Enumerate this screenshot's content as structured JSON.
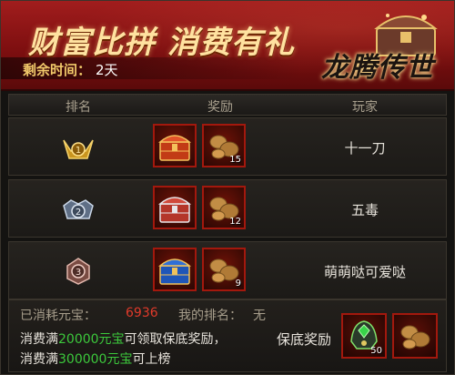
{
  "banner": {
    "title": "财富比拼  消费有礼",
    "remaining_label": "剩余时间：",
    "remaining_value": "2天",
    "logo_text": "龙腾传世"
  },
  "table": {
    "headers": {
      "rank": "排名",
      "reward": "奖励",
      "player": "玩家"
    },
    "rows": [
      {
        "rank": 1,
        "rank_icon": "gold-medal-1",
        "chest": "red-treasure-chest",
        "ore_qty": "15",
        "player": "十一刀"
      },
      {
        "rank": 2,
        "rank_icon": "silver-medal-2",
        "chest": "silver-treasure-chest",
        "ore_qty": "12",
        "player": "五毒"
      },
      {
        "rank": 3,
        "rank_icon": "bronze-medal-3",
        "chest": "blue-treasure-chest",
        "ore_qty": "9",
        "player": "萌萌哒可爱哒"
      }
    ]
  },
  "footer": {
    "spent_label": "已消耗元宝：",
    "spent_value": "6936",
    "my_rank_label": "我的排名：",
    "my_rank_value": "无",
    "line1_a": "消费满",
    "line1_hl": "20000元宝",
    "line1_b": "可领取保底奖励，",
    "line2_a": "消费满",
    "line2_hl": "300000元宝",
    "line2_b": "可上榜",
    "guarantee_label": "保底奖励",
    "guarantee_items": [
      {
        "icon": "green-gem-helmet",
        "qty": "50"
      },
      {
        "icon": "ore-lumps",
        "qty": ""
      }
    ]
  },
  "colors": {
    "accent_red": "#a3180d",
    "highlight_green": "#3cc93c",
    "spent_red": "#e03a2a",
    "gold": "#f1c96a"
  }
}
